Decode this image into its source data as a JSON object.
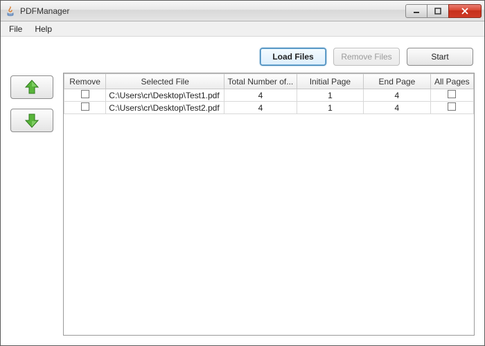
{
  "window": {
    "title": "PDFManager"
  },
  "menubar": {
    "items": [
      "File",
      "Help"
    ]
  },
  "toolbar": {
    "load_label": "Load Files",
    "remove_label": "Remove Files",
    "start_label": "Start"
  },
  "table": {
    "columns": {
      "remove": "Remove",
      "file": "Selected File",
      "total": "Total Number of...",
      "initial": "Initial Page",
      "end": "End Page",
      "all": "All Pages"
    },
    "rows": [
      {
        "remove": false,
        "file": "C:\\Users\\cr\\Desktop\\Test1.pdf",
        "total": "4",
        "initial": "1",
        "end": "4",
        "all": false
      },
      {
        "remove": false,
        "file": "C:\\Users\\cr\\Desktop\\Test2.pdf",
        "total": "4",
        "initial": "1",
        "end": "4",
        "all": false
      }
    ]
  }
}
